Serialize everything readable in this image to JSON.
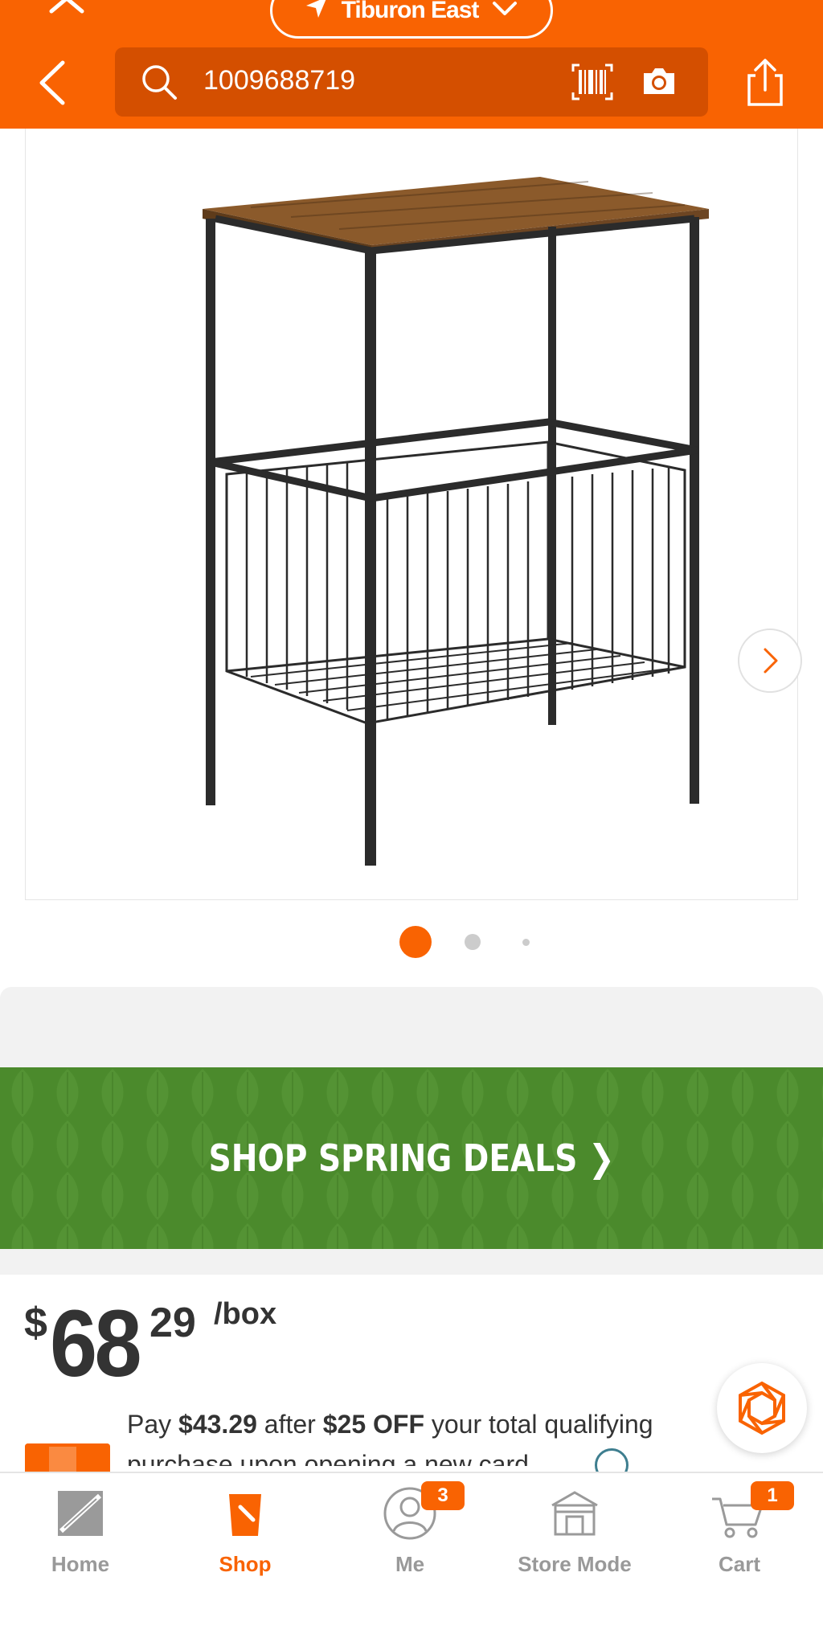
{
  "header": {
    "store_label": "Tiburon East",
    "search_value": "1009688719",
    "icons": [
      "close-icon",
      "location-arrow-icon",
      "chevron-down-icon",
      "back-icon",
      "search-icon",
      "barcode-icon",
      "camera-icon",
      "share-icon"
    ]
  },
  "gallery": {
    "image_alt": "Metal side table with rustic wood top and wire basket",
    "active_index": 1,
    "total": 3
  },
  "promo": {
    "label": "SHOP SPRING DEALS ❯",
    "color": "#4b8a2c"
  },
  "price": {
    "dollar_sign": "$",
    "whole": "68",
    "cents": "29",
    "unit": "/box"
  },
  "financing": {
    "pay_prefix": "Pay",
    "pay_amount": "$43.29",
    "after_text": "after",
    "discount": "$25 OFF",
    "rest": "your total qualifying",
    "line2": "purchase upon opening a new card"
  },
  "nav": {
    "items": [
      {
        "label": "Home",
        "icon": "home-depot-logo-icon"
      },
      {
        "label": "Shop",
        "icon": "shop-bucket-icon"
      },
      {
        "label": "Me",
        "icon": "user-icon",
        "badge": "3"
      },
      {
        "label": "Store Mode",
        "icon": "store-icon"
      },
      {
        "label": "Cart",
        "icon": "cart-icon",
        "badge": "1"
      }
    ]
  },
  "colors": {
    "brand_orange": "#f96302",
    "search_bg": "#d44f00",
    "promo_green": "#4b8a2c"
  }
}
